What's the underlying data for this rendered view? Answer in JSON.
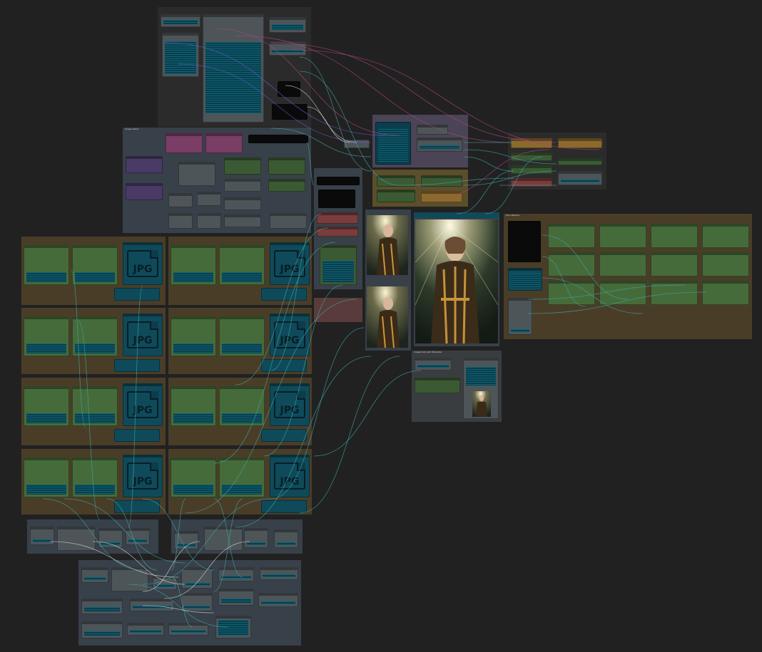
{
  "app": {
    "name": "node-graph-editor"
  },
  "groups": {
    "top_dark": {
      "title": ""
    },
    "image_select": {
      "title": "Image Select"
    },
    "mid_stack": {
      "title": ""
    },
    "purple_top": {
      "title": ""
    },
    "gold_mid": {
      "title": ""
    },
    "right_small": {
      "title": ""
    },
    "face_fix": {
      "title": "Face Restore"
    },
    "image_post": {
      "title": "Image Post with Metadata"
    },
    "bottom_a": {
      "title": ""
    },
    "bottom_b": {
      "title": ""
    }
  },
  "jpg_tiles": [
    {
      "label": "JPG"
    },
    {
      "label": "JPG"
    },
    {
      "label": "JPG"
    },
    {
      "label": "JPG"
    },
    {
      "label": "JPG"
    },
    {
      "label": "JPG"
    },
    {
      "label": "JPG"
    },
    {
      "label": "JPG"
    }
  ],
  "colors": {
    "canvas": "#212121",
    "wire_teal": "#3fa6a0",
    "wire_pink": "#b0447f",
    "wire_purple": "#6a5acd",
    "wire_white": "#d0d0d0"
  },
  "icons": [
    "jpg-file-icon"
  ]
}
